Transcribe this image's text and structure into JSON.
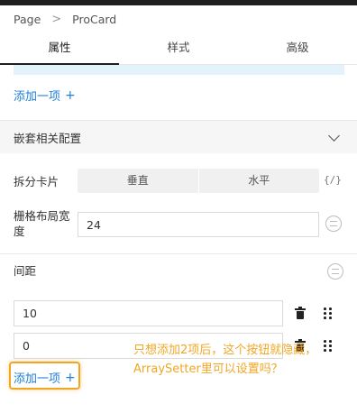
{
  "breadcrumb": {
    "root": "Page",
    "separator": ">",
    "current": "ProCard"
  },
  "tabs": [
    {
      "label": "属性",
      "active": true
    },
    {
      "label": "样式",
      "active": false
    },
    {
      "label": "高级",
      "active": false
    }
  ],
  "top_add_link": {
    "label": "添加一项",
    "plus": "+"
  },
  "section": {
    "title": "嵌套相关配置",
    "expanded": true
  },
  "split": {
    "label": "拆分卡片",
    "options": [
      "垂直",
      "水平"
    ],
    "code_icon_text": "{/}"
  },
  "grid_width": {
    "label": "栅格布局宽度",
    "value": "24"
  },
  "spacing": {
    "label": "间距",
    "items": [
      {
        "value": "10"
      },
      {
        "value": "0"
      }
    ],
    "add_link": {
      "label": "添加一项",
      "plus": "+"
    }
  },
  "annotation": {
    "text": "只想添加2项后，这个按钮就隐藏，ArraySetter里可以设置吗？"
  },
  "colors": {
    "accent": "#1d7fd6",
    "annotation": "#f0a623",
    "strip": "#e3f2fb"
  },
  "icons": [
    "chevron-right-icon",
    "chevron-down-icon",
    "code-icon",
    "variable-icon",
    "trash-icon",
    "drag-handle-icon",
    "plus-icon"
  ]
}
